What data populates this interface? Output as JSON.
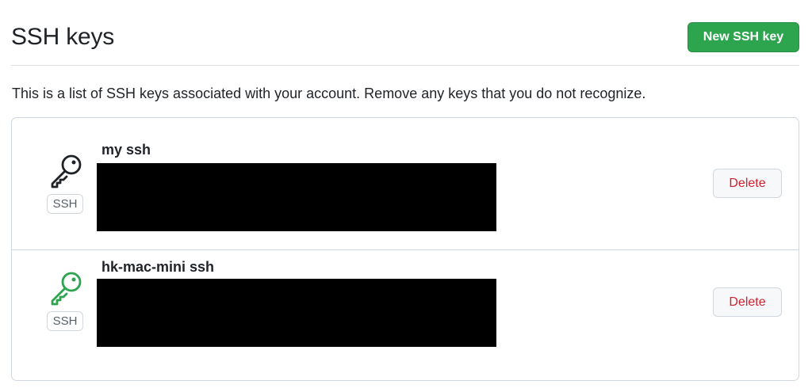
{
  "header": {
    "title": "SSH keys",
    "new_key_label": "New SSH key"
  },
  "description": "This is a list of SSH keys associated with your account. Remove any keys that you do not recognize.",
  "keys": [
    {
      "title": "my ssh",
      "badge": "SSH",
      "delete_label": "Delete",
      "icon": "key-icon",
      "icon_color": "#1f2328"
    },
    {
      "title": "hk-mac-mini ssh",
      "badge": "SSH",
      "delete_label": "Delete",
      "icon": "key-icon",
      "icon_color": "#2da44e"
    }
  ],
  "colors": {
    "primary_button": "#2da44e",
    "danger_text": "#cf222e",
    "border": "#d0d7de"
  }
}
